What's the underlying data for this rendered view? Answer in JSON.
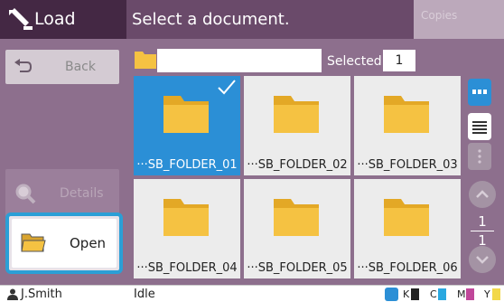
{
  "sidebar": {
    "title": "Load",
    "back_label": "Back",
    "details_label": "Details",
    "open_label": "Open"
  },
  "header": {
    "title": "Select a document.",
    "copies_label": "Copies"
  },
  "path_bar": {
    "path_value": "",
    "selected_label": "Selected",
    "selected_count": "1"
  },
  "folders": [
    {
      "name": "···SB_FOLDER_01",
      "selected": true
    },
    {
      "name": "···SB_FOLDER_02",
      "selected": false
    },
    {
      "name": "···SB_FOLDER_03",
      "selected": false
    },
    {
      "name": "···SB_FOLDER_04",
      "selected": false
    },
    {
      "name": "···SB_FOLDER_05",
      "selected": false
    },
    {
      "name": "···SB_FOLDER_06",
      "selected": false
    }
  ],
  "pagination": {
    "current": "1",
    "total": "1"
  },
  "view": {
    "active": "thumbnail",
    "icons": [
      "thumbnail-view-icon",
      "list-view-icon",
      "more-icon"
    ]
  },
  "status_bar": {
    "user": "J.Smith",
    "state": "Idle",
    "inks": [
      {
        "label": "K",
        "color": "#222222"
      },
      {
        "label": "C",
        "color": "#2aa8e0"
      },
      {
        "label": "M",
        "color": "#c0479a"
      },
      {
        "label": "Y",
        "color": "#f2d84a"
      }
    ]
  },
  "colors": {
    "accent": "#2b8fd6",
    "header": "#6a4a6a",
    "panel": "#8d6f8d",
    "folder": "#f5c242"
  }
}
